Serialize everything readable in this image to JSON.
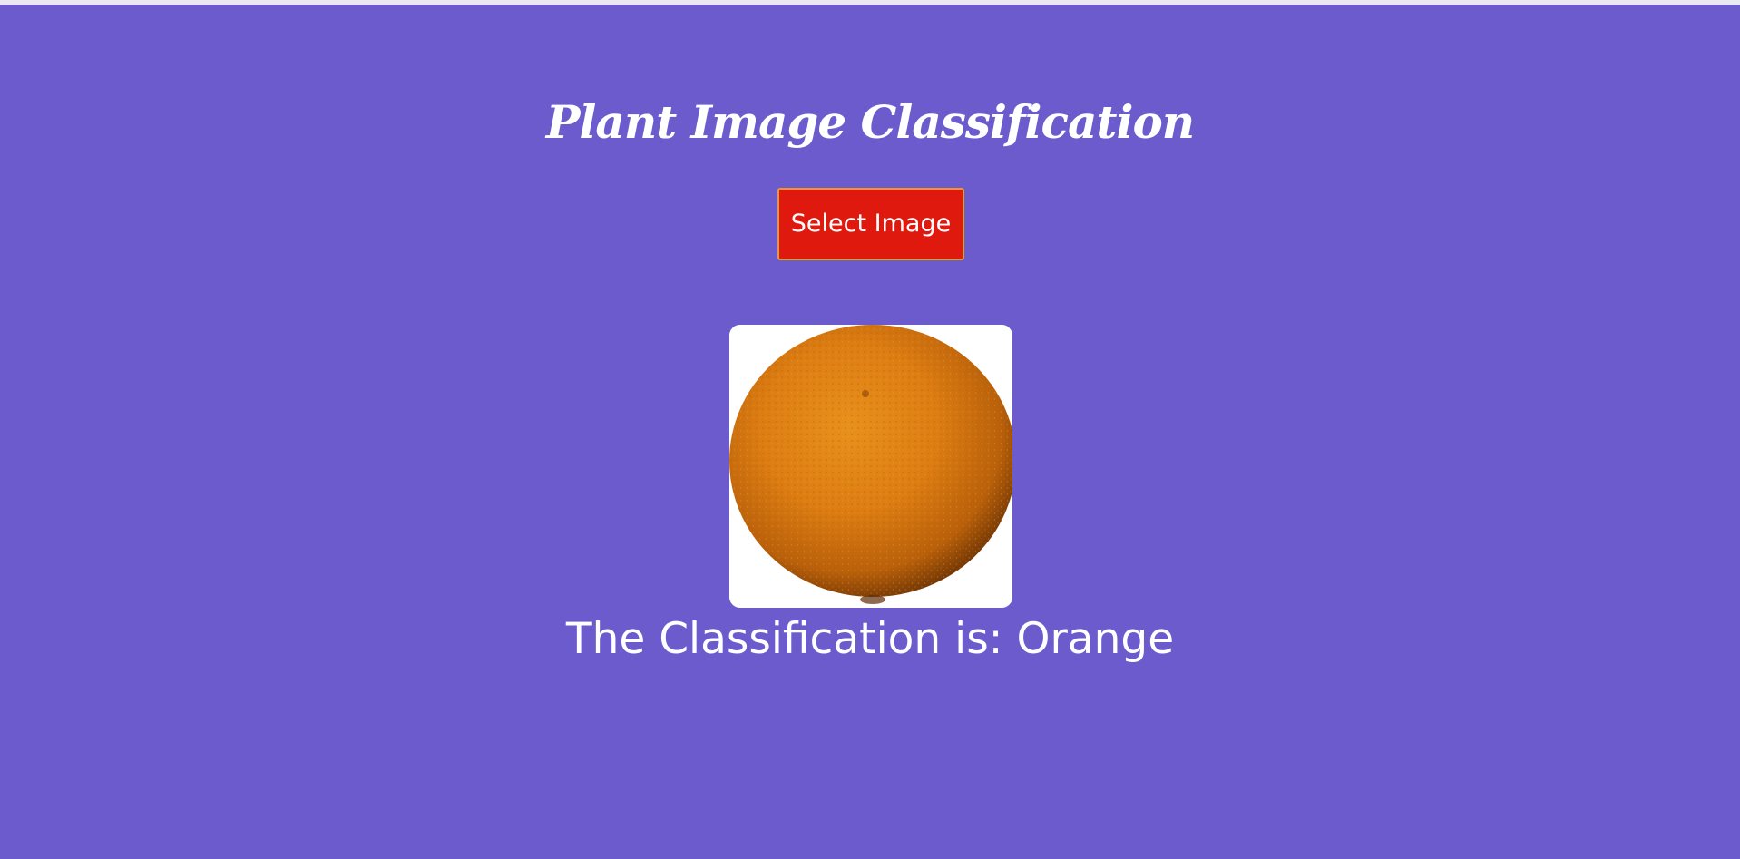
{
  "page": {
    "title": "Plant Image Classification",
    "background_color": "#6c5bcc"
  },
  "upload": {
    "button_label": "Select Image",
    "button_color": "#e0190f",
    "button_border_color": "#e79b2c"
  },
  "preview": {
    "image_subject": "orange-fruit",
    "fruit_color": "#dd7d12"
  },
  "result": {
    "text": "The Classification is: Orange"
  }
}
